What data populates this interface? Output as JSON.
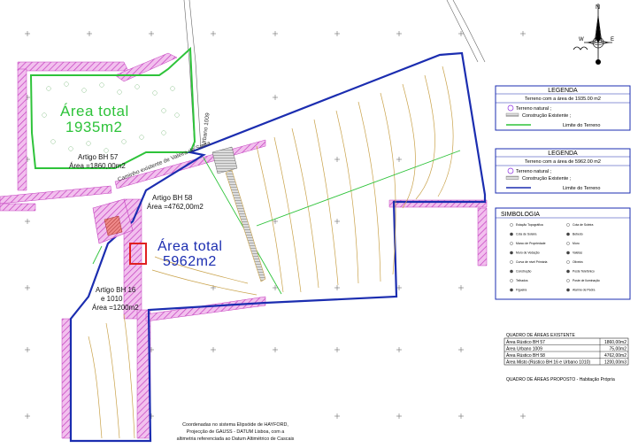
{
  "map": {
    "area_labels": {
      "green_total_line1": "Área total",
      "green_total_line2": "1935m2",
      "blue_total_line1": "Área total",
      "blue_total_line2": "5962m2"
    },
    "parcel_labels": [
      {
        "line1": "Artigo BH 57",
        "line2": "Área =1860,00m2"
      },
      {
        "line1": "Artigo BH 58",
        "line2": "Área =4762,00m2"
      },
      {
        "line1": "Artigo BH 16",
        "line2": "e 1010",
        "line3": "Área =1200m2"
      }
    ],
    "road_labels": {
      "vertical": "Urbano 1009",
      "diagonal": "Caminho existente de Valeira de Santa"
    },
    "footer_note": {
      "line1": "Coordenadas no sistema Elipsóide de HAYFORD,",
      "line2": "Projecção de GAUSS - DATUM Lisboa, com a",
      "line3": "altimetria referenciada ao Datum Altimétrico de Cascais"
    }
  },
  "compass": {
    "north": "N",
    "east": "E",
    "west": "W"
  },
  "legend1": {
    "title": "LEGENDA",
    "subtitle": "Terreno com a área de 1935.00 m2",
    "items": [
      "Terreno natural ;",
      "Construção Existente ;",
      "Limite do Terreno"
    ]
  },
  "legend2": {
    "title": "LEGENDA",
    "subtitle": "Terreno com a área de 5962.00 m2",
    "items": [
      "Terreno natural ;",
      "Construção Existente ;",
      "Limite do Terreno"
    ]
  },
  "simbologia": {
    "title": "SIMBOLOGIA",
    "left_items": [
      "Estação Topográfica",
      "Cota de Soleira",
      "Marco de Propriedade",
      "Muro de Vedação",
      "Curva de nível Primária",
      "Construção",
      "Telhados",
      "Figueira"
    ],
    "right_items": [
      "Cota de Soleira",
      "Bebedo",
      "Muro",
      "Valetas",
      "Oliveira",
      "Poste Telefónico",
      "Poste de Iluminação",
      "Alarme de Pedra"
    ]
  },
  "areas_table": {
    "title": "QUADRO DE ÁREAS EXISTENTE",
    "rows": [
      {
        "label": "Área Rústico BH 57",
        "value": "1860,00m2"
      },
      {
        "label": "Área Urbano 1009",
        "value": "75,00m2"
      },
      {
        "label": "Área Rústico BH 58",
        "value": "4762,00m2"
      },
      {
        "label": "Área Misto (Rústico BH 16 e Urbano 1010)",
        "value": "1200,00m3"
      }
    ],
    "proposed": "QUADRO DE ÁREAS PROPOSTO - Habitação Própria"
  },
  "colors": {
    "green_boundary": "#2ec33a",
    "blue_boundary": "#1b2db0",
    "pink_road": "#d64fd0",
    "contour": "#c9a24a",
    "red_building": "#e02020"
  }
}
